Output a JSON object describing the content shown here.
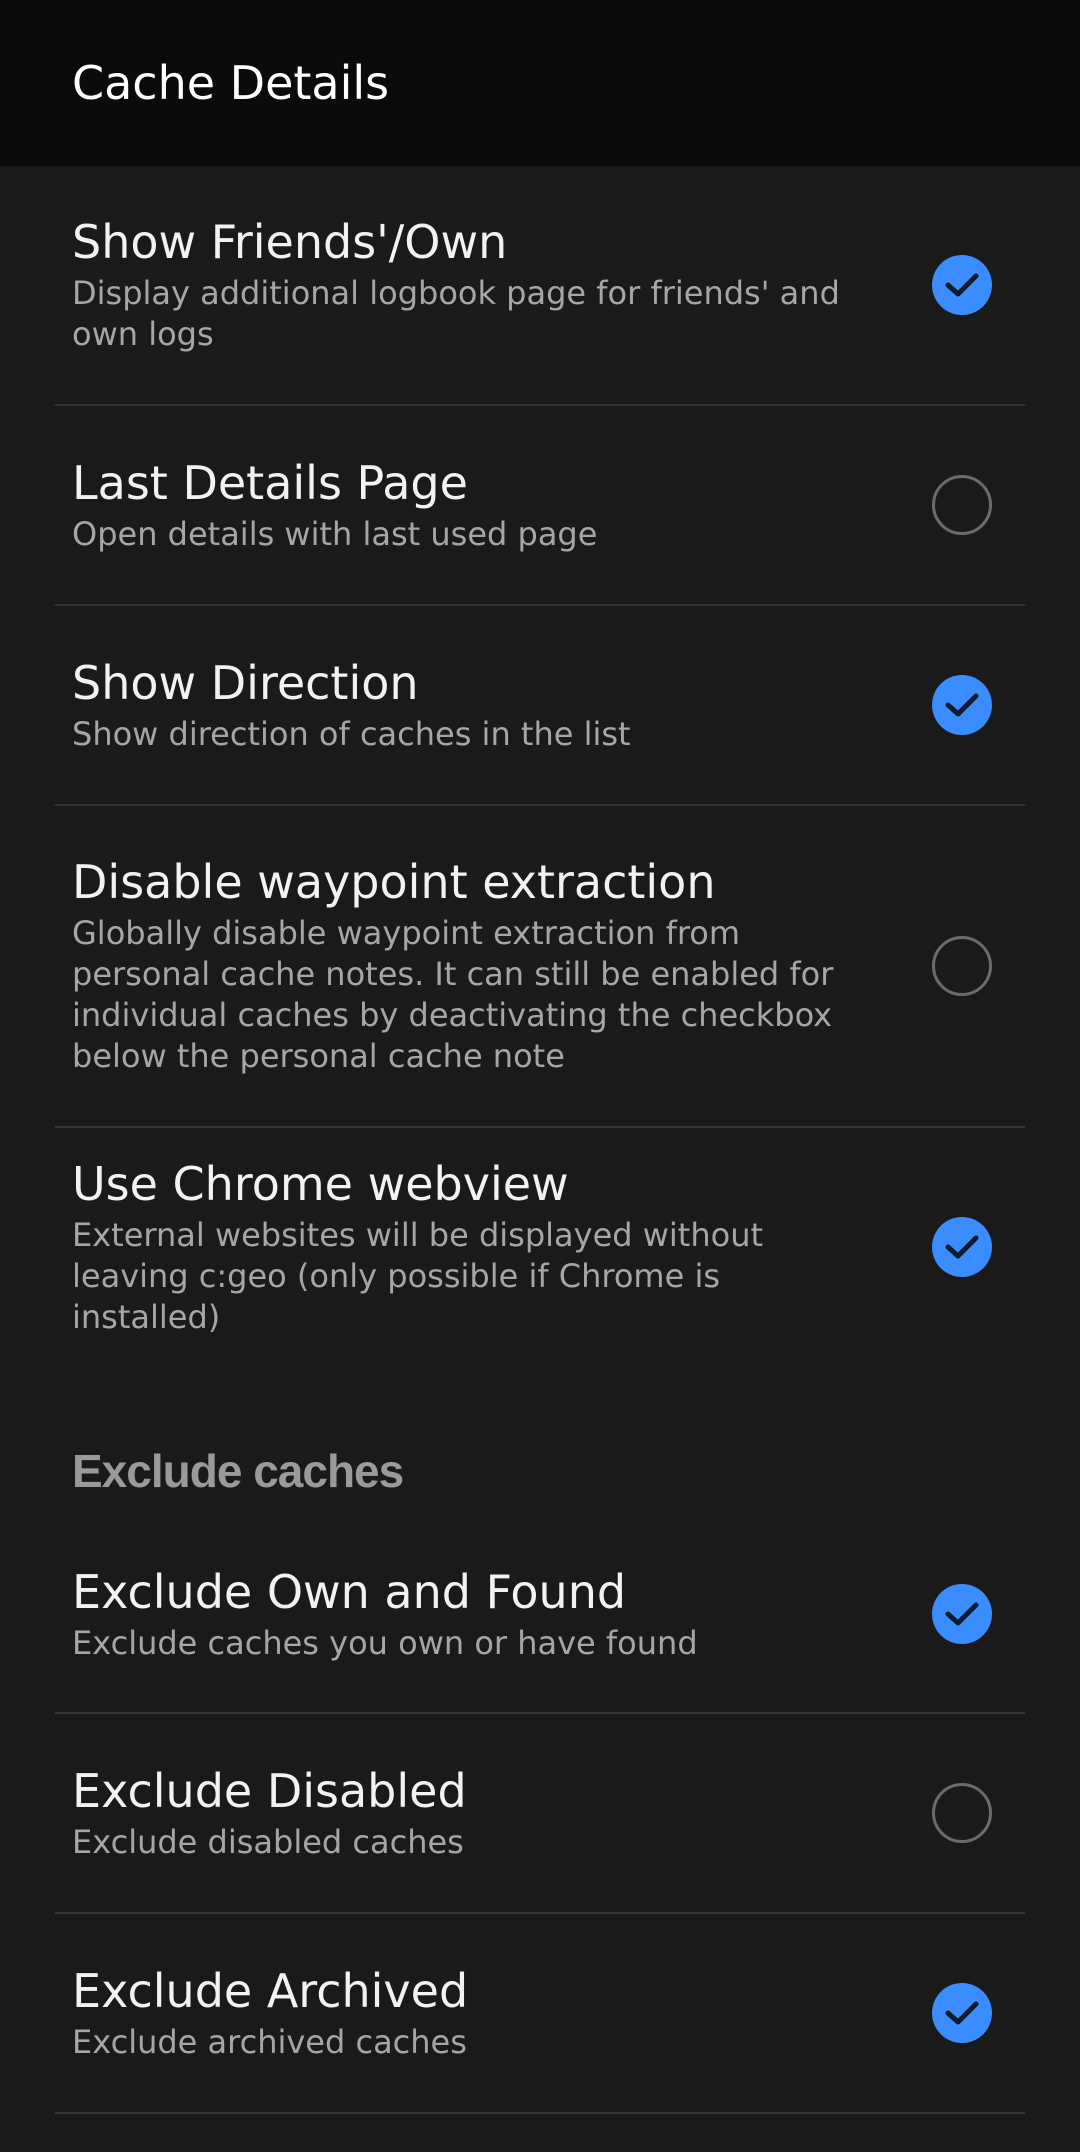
{
  "appbar": {
    "title": "Cache Details"
  },
  "items": [
    {
      "title": "Show Friends'/Own",
      "subtitle": "Display additional logbook page for friends' and own logs",
      "checked": true
    },
    {
      "title": "Last Details Page",
      "subtitle": "Open details with last used page",
      "checked": false
    },
    {
      "title": "Show Direction",
      "subtitle": "Show direction of caches in the list",
      "checked": true
    },
    {
      "title": "Disable waypoint extraction",
      "subtitle": "Globally disable waypoint extraction from personal cache notes. It can still be enabled for individual caches by deactivating the checkbox below the personal cache note",
      "checked": false
    },
    {
      "title": "Use Chrome webview",
      "subtitle": "External websites will be displayed without leaving c:geo (only possible if Chrome is installed)",
      "checked": true
    }
  ],
  "section": {
    "title": "Exclude caches"
  },
  "exclude_items": [
    {
      "title": "Exclude Own and Found",
      "subtitle": "Exclude caches you own or have found",
      "checked": true
    },
    {
      "title": "Exclude Disabled",
      "subtitle": "Exclude disabled caches",
      "checked": false
    },
    {
      "title": "Exclude Archived",
      "subtitle": "Exclude archived caches",
      "checked": true
    }
  ],
  "colors": {
    "accent": "#3b8cff",
    "background": "#1a1a1a",
    "appbar": "#0b0b0b"
  },
  "icons": {
    "checked": "check-icon",
    "unchecked": "empty-circle"
  }
}
